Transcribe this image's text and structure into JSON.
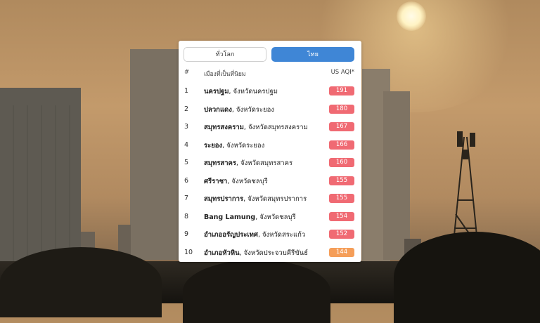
{
  "tabs": {
    "global": "ทั่วโลก",
    "thai": "ไทย",
    "active": "thai"
  },
  "table": {
    "header": {
      "rank": "#",
      "city": "เมืองที่เป็นที่นิยม",
      "aqi": "US AQI*"
    },
    "rows": [
      {
        "rank": "1",
        "city": "นครปฐม",
        "province": ", จังหวัดนครปฐม",
        "aqi": "191",
        "color": "#f06a73"
      },
      {
        "rank": "2",
        "city": "ปลวกแดง",
        "province": ", จังหวัดระยอง",
        "aqi": "180",
        "color": "#f06a73"
      },
      {
        "rank": "3",
        "city": "สมุทรสงคราม",
        "province": ", จังหวัดสมุทรสงคราม",
        "aqi": "167",
        "color": "#f06a73"
      },
      {
        "rank": "4",
        "city": "ระยอง",
        "province": ", จังหวัดระยอง",
        "aqi": "166",
        "color": "#f06a73"
      },
      {
        "rank": "5",
        "city": "สมุทรสาคร",
        "province": ", จังหวัดสมุทรสาคร",
        "aqi": "160",
        "color": "#f06a73"
      },
      {
        "rank": "6",
        "city": "ศรีราชา",
        "province": ", จังหวัดชลบุรี",
        "aqi": "155",
        "color": "#f06a73"
      },
      {
        "rank": "7",
        "city": "สมุทรปราการ",
        "province": ", จังหวัดสมุทรปราการ",
        "aqi": "155",
        "color": "#f06a73"
      },
      {
        "rank": "8",
        "city": "Bang Lamung",
        "province": ", จังหวัดชลบุรี",
        "aqi": "154",
        "color": "#f06a73"
      },
      {
        "rank": "9",
        "city": "อำเภออรัญประเทศ",
        "province": ", จังหวัดสระแก้ว",
        "aqi": "152",
        "color": "#f06a73"
      },
      {
        "rank": "10",
        "city": "อำเภอหัวหิน",
        "province": ", จังหวัดประจวบคีรีขันธ์",
        "aqi": "144",
        "color": "#f59e59"
      }
    ]
  }
}
